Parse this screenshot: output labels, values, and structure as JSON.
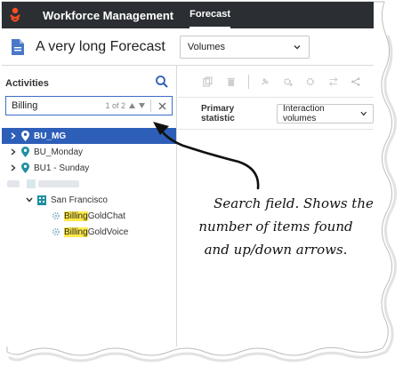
{
  "topbar": {
    "app_title": "Workforce Management",
    "tab_forecast": "Forecast"
  },
  "header": {
    "forecast_name": "A very long Forecast",
    "view_select": "Volumes"
  },
  "activities": {
    "label": "Activities",
    "search_value": "Billing",
    "search_count": "1 of 2"
  },
  "tree": [
    {
      "label": "BU_MG",
      "selected": true
    },
    {
      "label": "BU_Monday"
    },
    {
      "label": "BU1 - Sunday"
    },
    {
      "label": "San Francisco"
    },
    {
      "label_hl": "Billing",
      "label_rest": "GoldChat"
    },
    {
      "label_hl": "Billing",
      "label_rest": "GoldVoice"
    }
  ],
  "right": {
    "primary_label": "Primary statistic",
    "primary_value": "Interaction volumes"
  },
  "callout": {
    "line1": "Search field. Shows the",
    "line2": "number of items found",
    "line3": "and up/down arrows."
  },
  "colors": {
    "topbar": "#2b2f33",
    "brand": "#ff4f1f",
    "accent": "#2d5fb8",
    "highlight": "#ffe94a",
    "teal": "#1f8fa0"
  }
}
